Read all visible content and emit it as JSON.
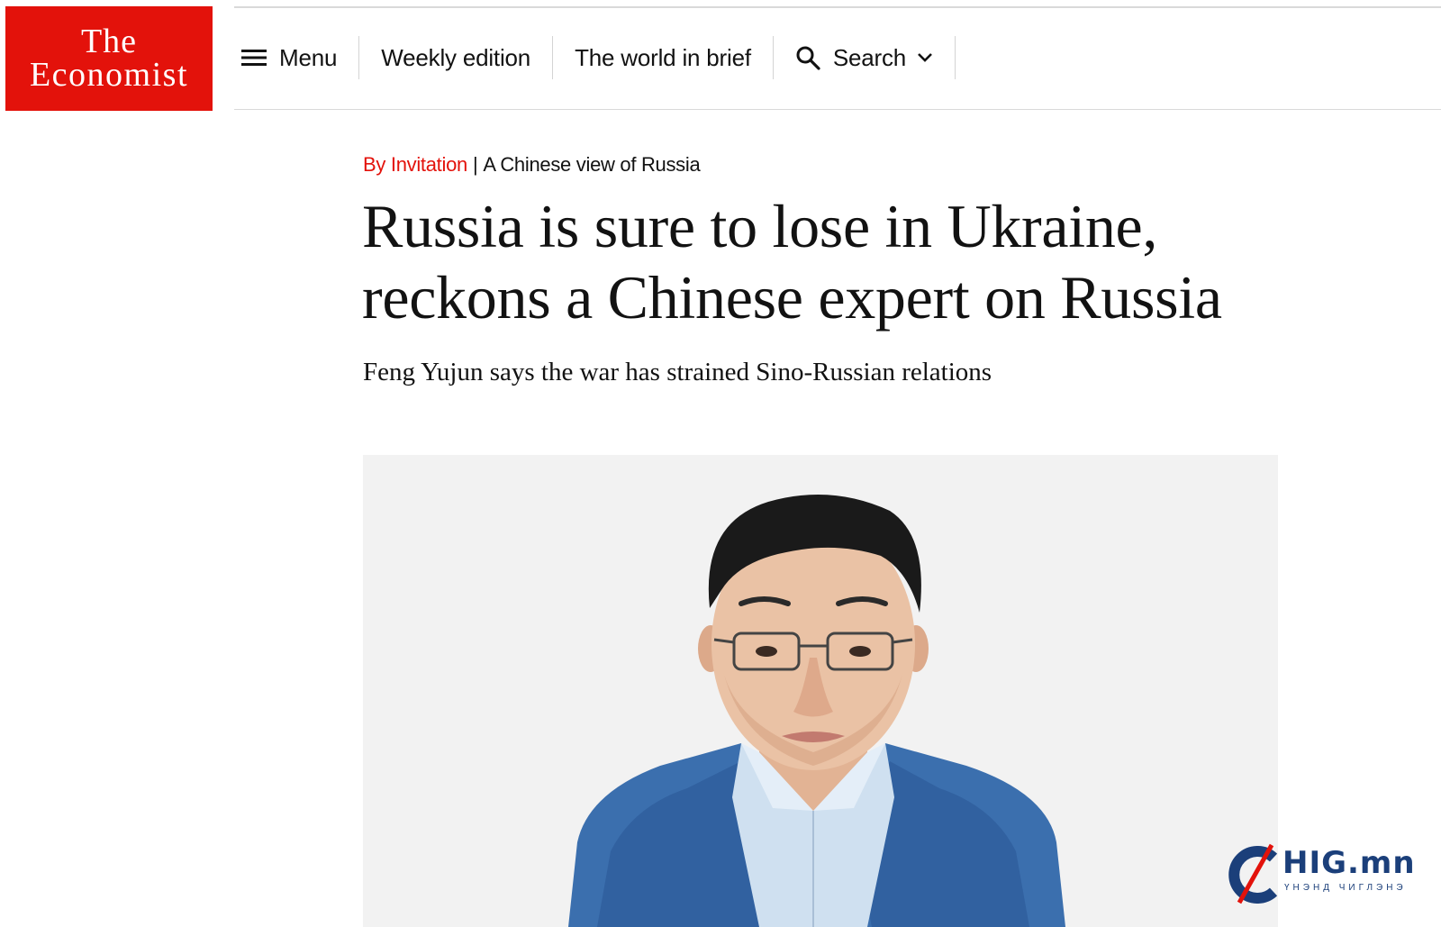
{
  "brand": {
    "logo_line1": "The",
    "logo_line2": "Economist",
    "color": "#e3120b"
  },
  "nav": {
    "menu_icon": "hamburger-icon",
    "menu_label": "Menu",
    "weekly_label": "Weekly edition",
    "brief_label": "The world in brief",
    "search_icon": "search-icon",
    "search_label": "Search",
    "search_chevron": "chevron-down-icon"
  },
  "article": {
    "section": "By Invitation",
    "separator": "|",
    "flytitle": "A Chinese view of Russia",
    "headline": "Russia is sure to lose in Ukraine, reckons a Chinese expert on Russia",
    "standfirst": "Feng Yujun says the war has strained Sino-Russian relations",
    "image_subject": "illustrated portrait"
  },
  "watermark": {
    "main": "HIG.mn",
    "sub": "ҮНЭНД ЧИГЛЭНЭ",
    "color": "#1b3f7a"
  }
}
